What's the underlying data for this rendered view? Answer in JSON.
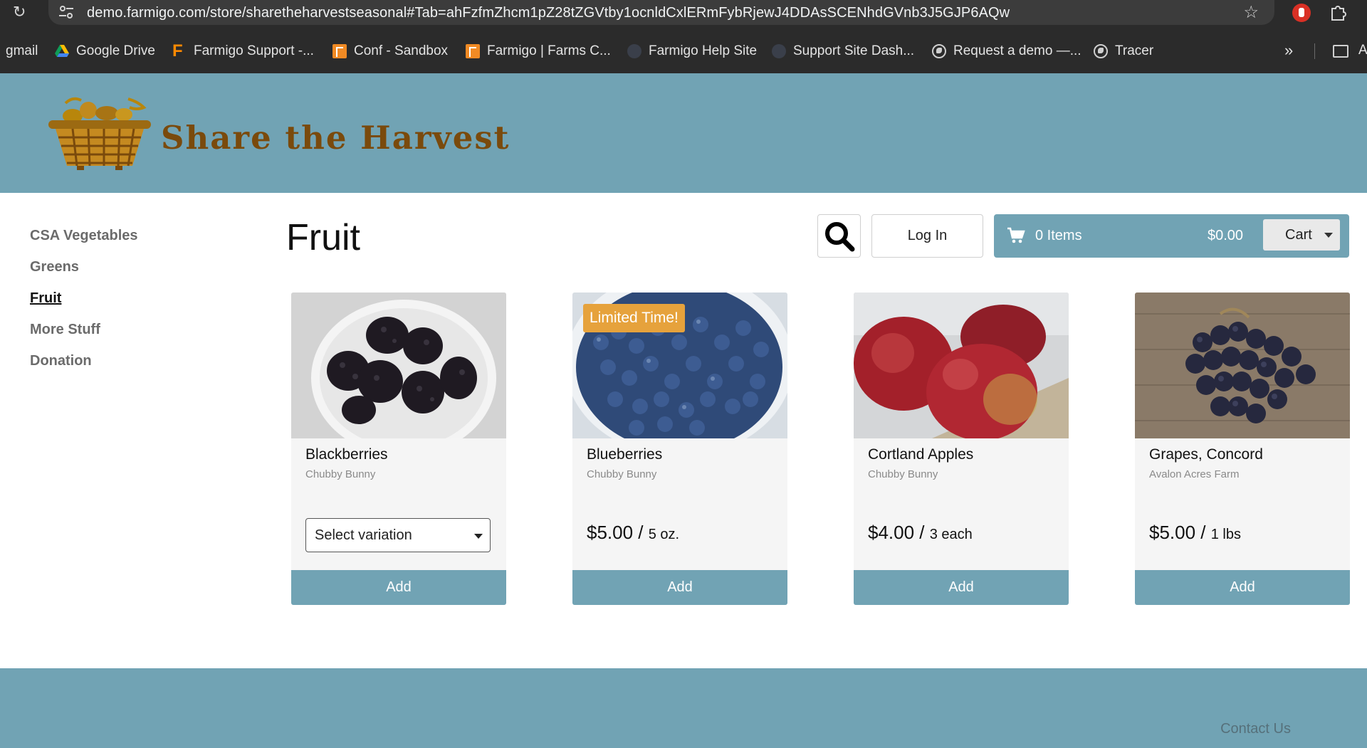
{
  "browser": {
    "url": "demo.farmigo.com/store/sharetheharvestseasonal#Tab=ahFzfmZhcm1pZ28tZGVtby1ocnldCxlERmFybRjewJ4DDAsSCENhdGVnb3J5GJP6AQw",
    "bookmarks": [
      {
        "label": "gmail",
        "icon": "none"
      },
      {
        "label": "Google Drive",
        "icon": "google-drive-icon"
      },
      {
        "label": "Farmigo Support -...",
        "icon": "farmigo-f-icon"
      },
      {
        "label": "Conf - Sandbox",
        "icon": "farmigo-square-icon"
      },
      {
        "label": "Farmigo | Farms C...",
        "icon": "farmigo-square-icon"
      },
      {
        "label": "Farmigo Help Site",
        "icon": "site-icon"
      },
      {
        "label": "Support Site Dash...",
        "icon": "site-icon"
      },
      {
        "label": "Request a demo —...",
        "icon": "globe-icon"
      },
      {
        "label": "Tracer",
        "icon": "globe-icon"
      }
    ],
    "overflow_label": "»",
    "folder_label": "A"
  },
  "site": {
    "name": "Share the Harvest"
  },
  "sidebar": {
    "items": [
      {
        "label": "CSA Vegetables",
        "active": false
      },
      {
        "label": "Greens",
        "active": false
      },
      {
        "label": "Fruit",
        "active": true
      },
      {
        "label": "More Stuff",
        "active": false
      },
      {
        "label": "Donation",
        "active": false
      }
    ]
  },
  "main": {
    "title": "Fruit",
    "login_label": "Log In",
    "cart": {
      "items_label": "0 Items",
      "total": "$0.00",
      "button_label": "Cart"
    }
  },
  "products": [
    {
      "name": "Blackberries",
      "farm": "Chubby Bunny",
      "select_label": "Select variation",
      "price": "",
      "unit": "",
      "badge": "",
      "add_label": "Add"
    },
    {
      "name": "Blueberries",
      "farm": "Chubby Bunny",
      "select_label": "",
      "price": "$5.00 /",
      "unit": "5 oz.",
      "badge": "Limited Time!",
      "add_label": "Add"
    },
    {
      "name": "Cortland Apples",
      "farm": "Chubby Bunny",
      "select_label": "",
      "price": "$4.00 /",
      "unit": "3 each",
      "badge": "",
      "add_label": "Add"
    },
    {
      "name": "Grapes, Concord",
      "farm": "Avalon Acres Farm",
      "select_label": "",
      "price": "$5.00 /",
      "unit": "1 lbs",
      "badge": "",
      "add_label": "Add"
    }
  ],
  "footer": {
    "contact_label": "Contact Us"
  },
  "colors": {
    "brand": "#71a3b4",
    "badge": "#e6a23c",
    "logo_text": "#7a4a0c"
  }
}
